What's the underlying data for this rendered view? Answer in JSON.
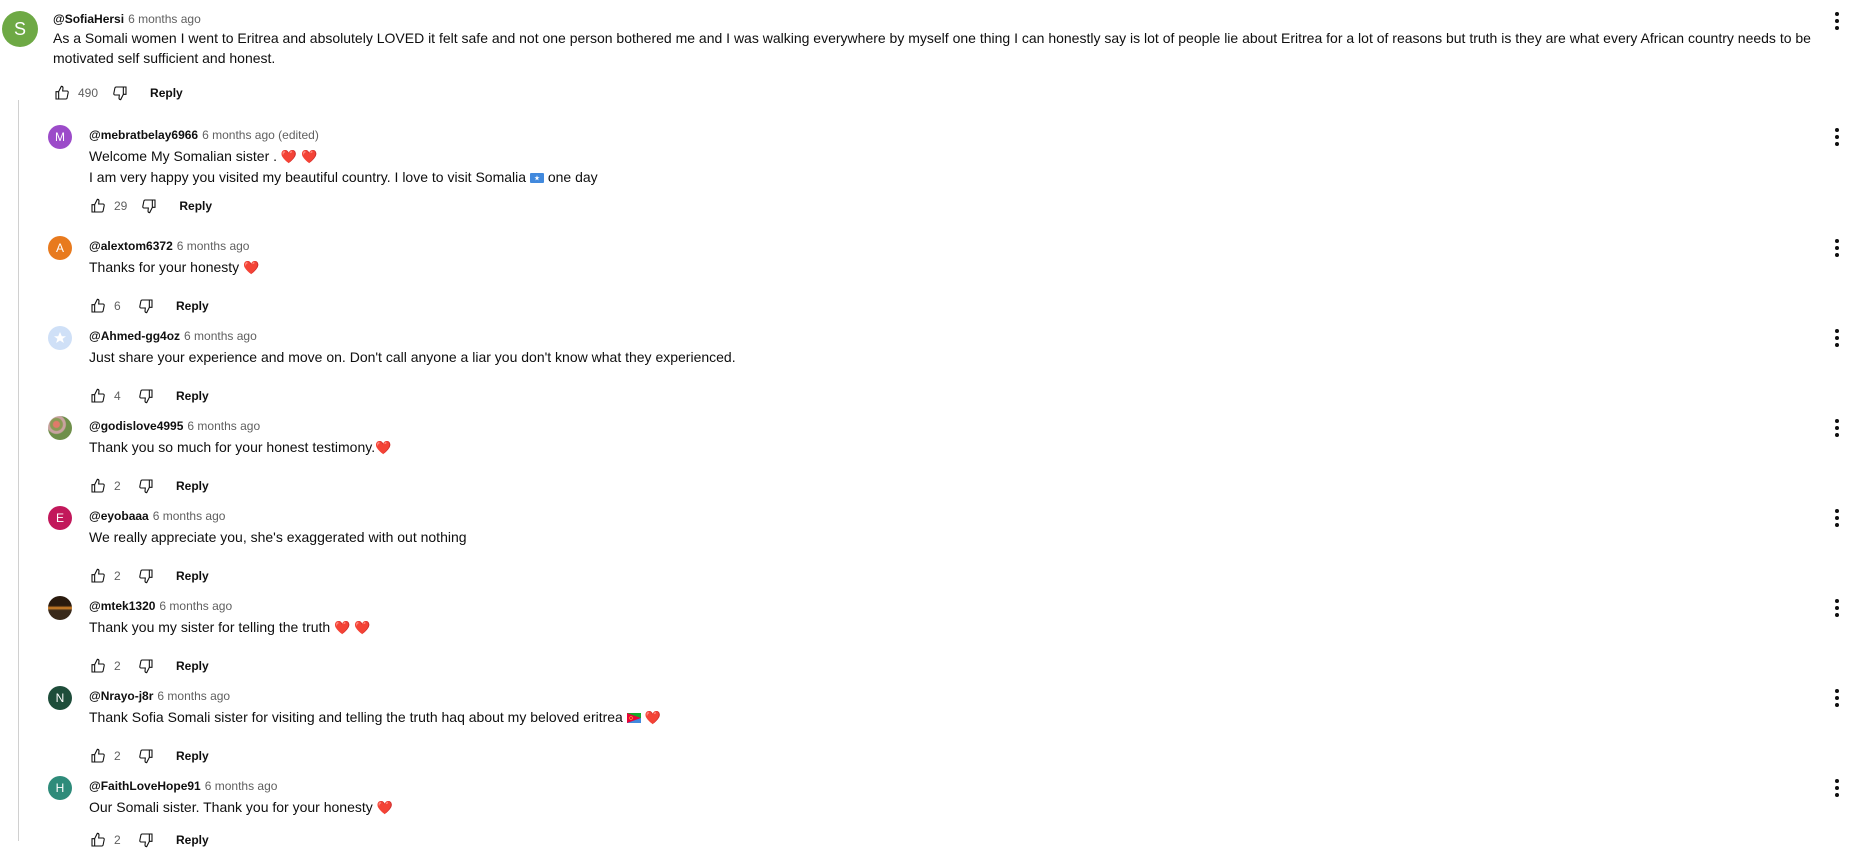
{
  "main": {
    "avatar_letter": "S",
    "author": "@SofiaHersi",
    "time": "6 months ago",
    "text_line1": "As a Somali women I went to Eritrea and absolutely LOVED it felt safe and not one person bothered me and I was walking everywhere by myself one thing I can honestly say is lot of people lie about Eritrea for a lot of reasons but truth is they are what every African country needs to be",
    "text_line2": "motivated self sufficient and honest.",
    "likes": "490",
    "reply_label": "Reply"
  },
  "replies": [
    {
      "avatar_letter": "M",
      "avatar_color": "#9c4bc9",
      "author": "@mebratbelay6966",
      "time": "6 months ago (edited)",
      "text": "Welcome My Somalian sister .",
      "text2": "I am very happy you visited my beautiful country. I love to visit Somalia",
      "text2_tail": "one day",
      "likes": "29",
      "reply_label": "Reply"
    },
    {
      "avatar_letter": "A",
      "avatar_color": "#e87a1e",
      "author": "@alextom6372",
      "time": "6 months ago",
      "text": "Thanks for your honesty",
      "likes": "6",
      "reply_label": "Reply"
    },
    {
      "avatar_letter": "",
      "avatar_color": "#cfe0f7",
      "author": "@Ahmed-gg4oz",
      "time": "6 months ago",
      "text": "Just share your experience and move on. Don't call anyone a liar you don't know what they experienced.",
      "likes": "4",
      "reply_label": "Reply"
    },
    {
      "avatar_letter": "",
      "avatar_color": "#8a9a55",
      "author": "@godislove4995",
      "time": "6 months ago",
      "text": "Thank you so much for your honest testimony.",
      "likes": "2",
      "reply_label": "Reply"
    },
    {
      "avatar_letter": "E",
      "avatar_color": "#c2185b",
      "author": "@eyobaaa",
      "time": "6 months ago",
      "text": "We really appreciate you, she's exaggerated with out nothing",
      "likes": "2",
      "reply_label": "Reply"
    },
    {
      "avatar_letter": "",
      "avatar_color": "#3a2a1a",
      "author": "@mtek1320",
      "time": "6 months ago",
      "text": "Thank you my sister for telling the truth",
      "likes": "2",
      "reply_label": "Reply"
    },
    {
      "avatar_letter": "N",
      "avatar_color": "#1e4d3a",
      "author": "@Nrayo-j8r",
      "time": "6 months ago",
      "text": "Thank Sofia Somali sister for visiting and telling the truth haq about my beloved eritrea",
      "likes": "2",
      "reply_label": "Reply"
    },
    {
      "avatar_letter": "H",
      "avatar_color": "#2e8b7a",
      "author": "@FaithLoveHope91",
      "time": "6 months ago",
      "text": "Our Somali sister. Thank you for your honesty",
      "likes": "2",
      "reply_label": "Reply"
    }
  ],
  "icons": {
    "like": "thumbs-up-icon",
    "dislike": "thumbs-down-icon",
    "menu": "more-vert-icon",
    "heart": "red-heart-emoji",
    "flag_somalia": "somalia-flag-emoji",
    "flag_eritrea": "eritrea-flag-emoji"
  }
}
